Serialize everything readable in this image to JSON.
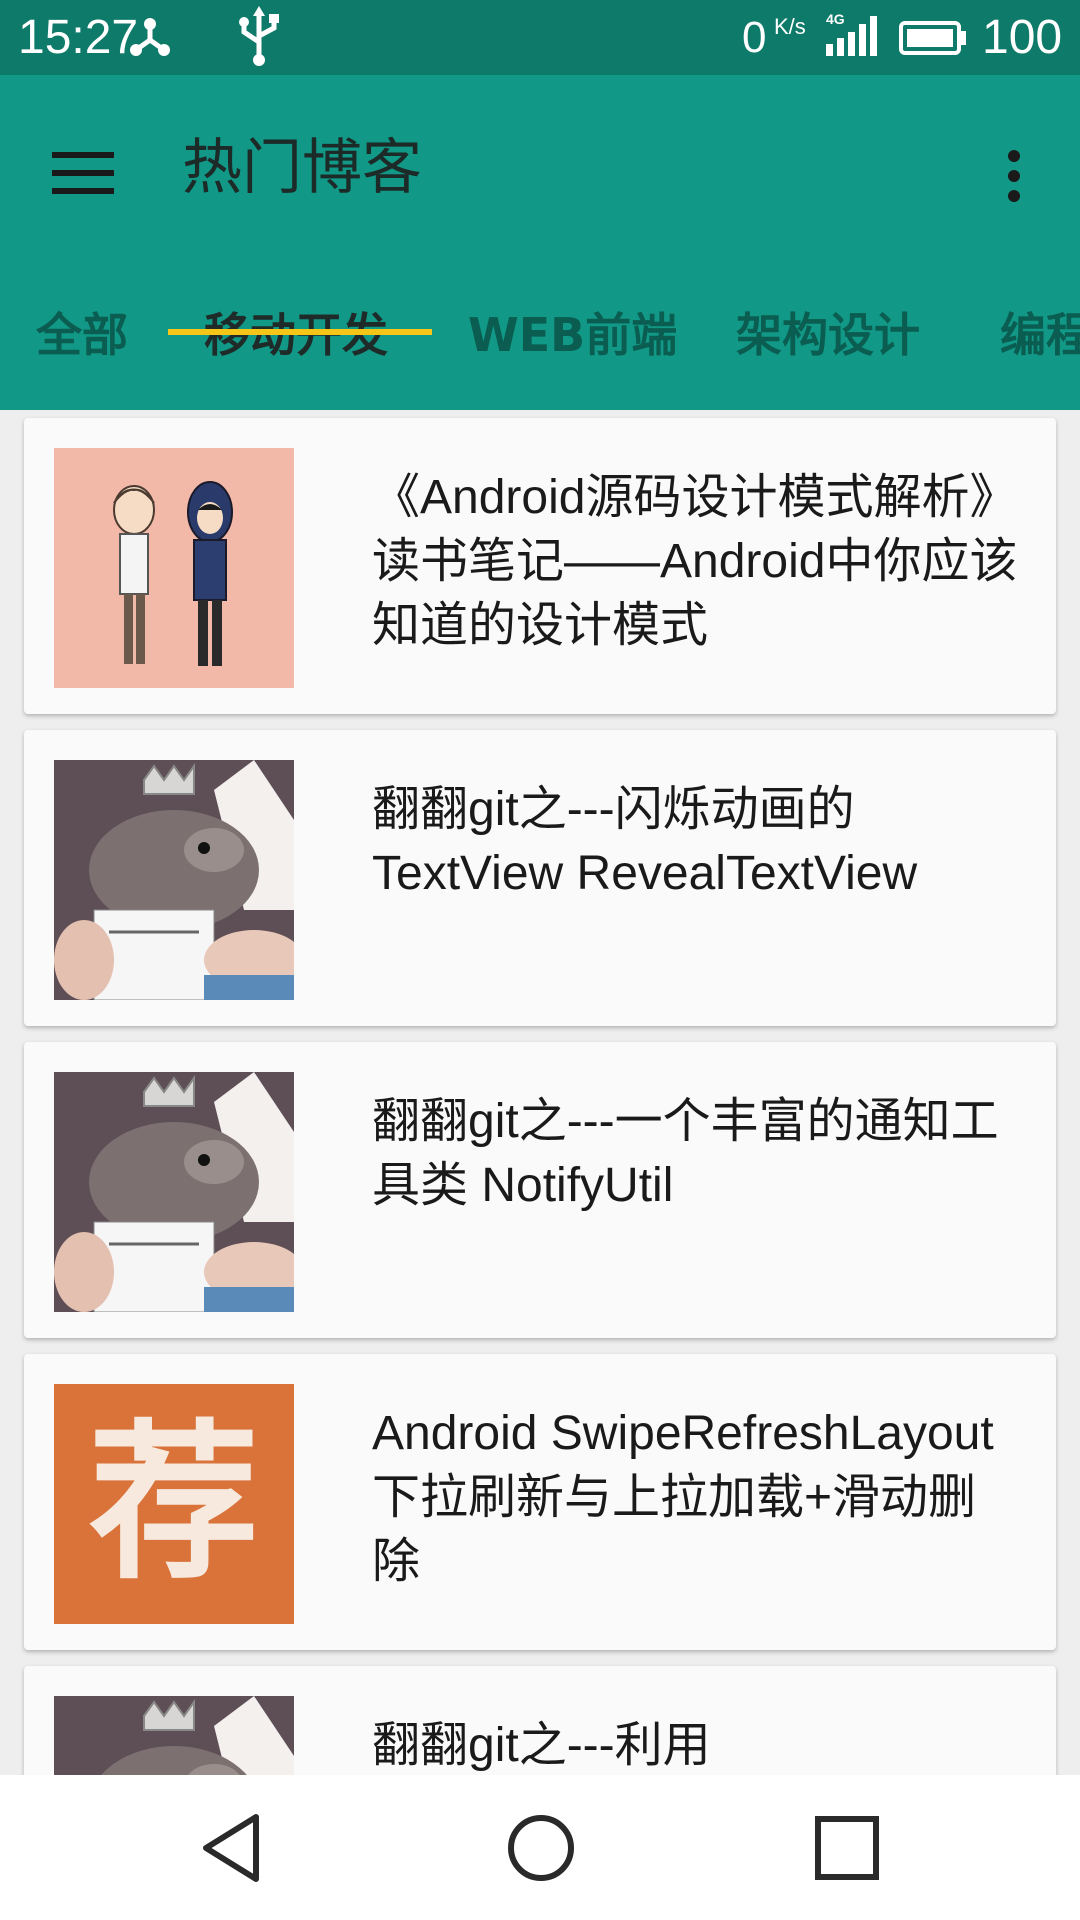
{
  "status_bar": {
    "time": "15:27",
    "net_speed": "0",
    "net_unit": "K/s",
    "signal_label": "4G",
    "battery_level": "100"
  },
  "app_bar": {
    "title": "热门博客",
    "menu_icon": "hamburger-menu-icon",
    "overflow_icon": "more-vert-icon",
    "background_color": "#119886",
    "indicator_color": "#f5c518"
  },
  "tabs": [
    {
      "label": "全部",
      "active": false
    },
    {
      "label": "移动开发",
      "active": true
    },
    {
      "label": "WEB前端",
      "active": false
    },
    {
      "label": "架构设计",
      "active": false
    },
    {
      "label": "编程语言",
      "active": false
    }
  ],
  "posts": [
    {
      "title": "《Android源码设计模式解析》读书笔记——Android中你应该知道的设计模式",
      "thumbnail": "cartoon-boys"
    },
    {
      "title": "翻翻git之---闪烁动画的TextView RevealTextView",
      "thumbnail": "hamster-photo"
    },
    {
      "title": "翻翻git之---一个丰富的通知工具类 NotifyUtil",
      "thumbnail": "hamster-photo"
    },
    {
      "title": "Android SwipeRefreshLayout下拉刷新与上拉加载+滑动删除",
      "thumbnail": "recommend-badge"
    },
    {
      "title": "翻翻git之---利用",
      "thumbnail": "hamster-photo"
    }
  ],
  "recommend_badge_char": "荐",
  "nav_bar": {
    "back_icon": "back-triangle-icon",
    "home_icon": "home-circle-icon",
    "recents_icon": "recents-square-icon"
  }
}
